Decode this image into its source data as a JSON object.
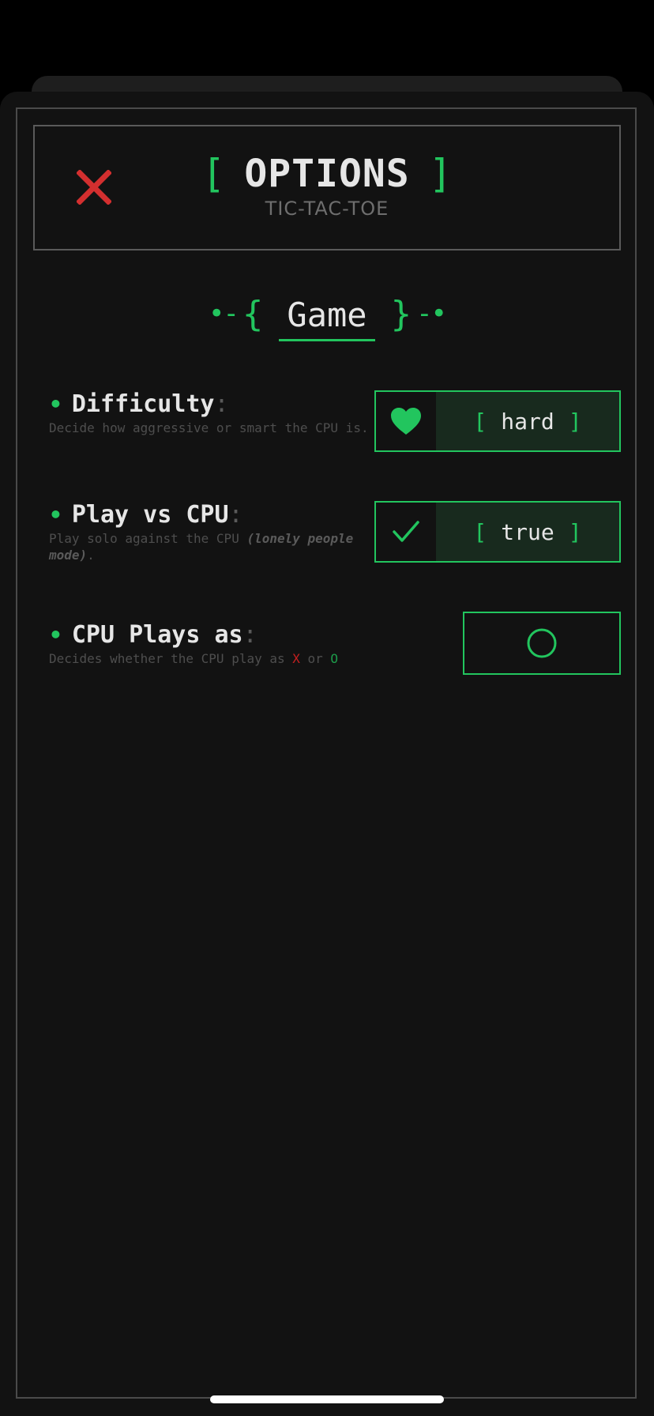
{
  "header": {
    "title": "OPTIONS",
    "bracket_left": "[",
    "bracket_right": "]",
    "subtitle": "TIC-TAC-TOE",
    "close_icon": "close-x-icon"
  },
  "section": {
    "title": "Game",
    "deco_left": "•-",
    "brace_left": "{",
    "brace_right": "}",
    "deco_right": "-•"
  },
  "options": {
    "difficulty": {
      "bullet": "•",
      "label": "Difficulty",
      "colon": ":",
      "description": "Decide how aggressive or smart the CPU is.",
      "icon": "heart-icon",
      "bracket_left": "[",
      "value": "hard",
      "bracket_right": "]"
    },
    "play_vs_cpu": {
      "bullet": "•",
      "label": "Play vs CPU",
      "colon": ":",
      "description_prefix": "Play solo against the CPU ",
      "description_emphasis": "(lonely people mode)",
      "description_suffix": ".",
      "icon": "checkmark-icon",
      "bracket_left": "[",
      "value": "true",
      "bracket_right": "]"
    },
    "cpu_plays_as": {
      "bullet": "•",
      "label": "CPU Plays as",
      "colon": ":",
      "description_prefix": "Decides whether the CPU play as ",
      "x_mark": "X",
      "description_mid": " or ",
      "o_mark": "O",
      "selected_icon": "circle-o-icon"
    }
  },
  "colors": {
    "accent": "#22c55e",
    "danger": "#d32f2f",
    "background": "#121212",
    "text": "#e6e6e6"
  }
}
